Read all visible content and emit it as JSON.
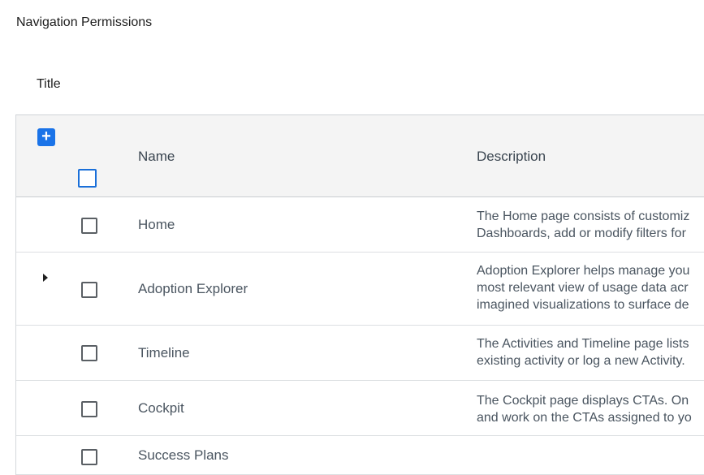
{
  "header": {
    "title": "Navigation Permissions"
  },
  "section": {
    "title": "Title"
  },
  "table": {
    "add_icon": "plus-icon",
    "columns": {
      "name": "Name",
      "description": "Description"
    },
    "rows": [
      {
        "name": "Home",
        "checked": false,
        "expandable": false,
        "description": [
          "The Home page consists of customiz",
          "Dashboards, add or modify filters for"
        ]
      },
      {
        "name": "Adoption Explorer",
        "checked": false,
        "expandable": true,
        "description": [
          "Adoption Explorer helps manage you",
          "most relevant view of usage data acr",
          "imagined visualizations to surface de"
        ]
      },
      {
        "name": "Timeline",
        "checked": false,
        "expandable": false,
        "description": [
          "The Activities and Timeline page lists",
          "existing activity or log a new Activity."
        ]
      },
      {
        "name": "Cockpit",
        "checked": false,
        "expandable": false,
        "description": [
          "The Cockpit page displays CTAs. On",
          "and work on the CTAs assigned to yo"
        ]
      },
      {
        "name": "Success Plans",
        "checked": false,
        "expandable": false,
        "description": []
      }
    ]
  },
  "colors": {
    "accent": "#1a73e8",
    "header_bg": "#f4f4f4"
  }
}
